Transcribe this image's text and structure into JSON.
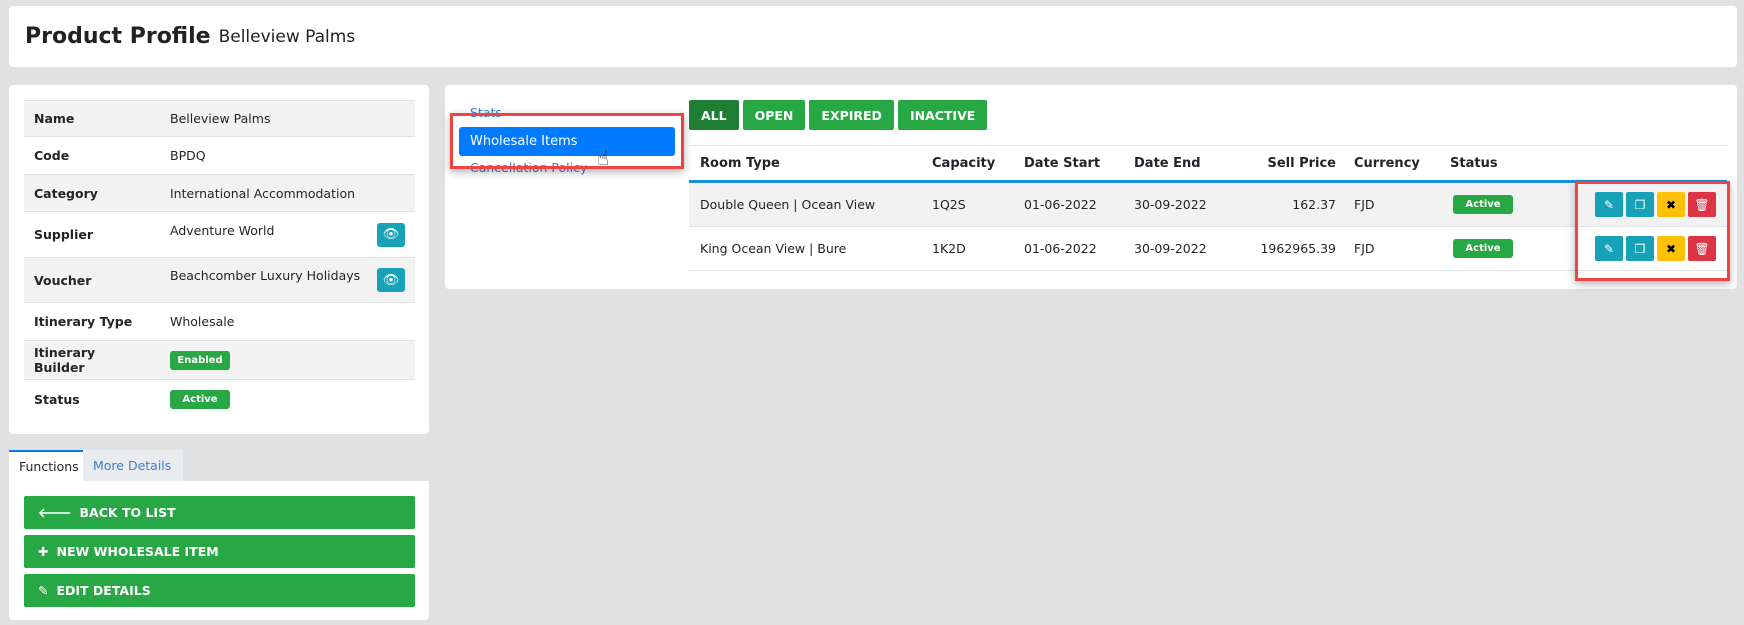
{
  "header": {
    "title": "Product Profile",
    "subtitle": "Belleview Palms"
  },
  "info": [
    {
      "label": "Name",
      "value": "Belleview Palms"
    },
    {
      "label": "Code",
      "value": "BPDQ"
    },
    {
      "label": "Category",
      "value": "International Accommodation"
    },
    {
      "label": "Supplier",
      "value": "Adventure World"
    },
    {
      "label": "Voucher",
      "value": "Beachcomber Luxury Holidays"
    },
    {
      "label": "Itinerary Type",
      "value": "Wholesale"
    },
    {
      "label": "Itinerary Builder",
      "value": "Enabled"
    },
    {
      "label": "Status",
      "value": "Active"
    }
  ],
  "tabs": {
    "functions": "Functions",
    "more": "More Details"
  },
  "functions": [
    "BACK TO LIST",
    "NEW WHOLESALE ITEM",
    "EDIT DETAILS"
  ],
  "nav": {
    "stats": "Stats",
    "wholesale": "Wholesale Items",
    "cancellation": "Cancellation Policy"
  },
  "filters": [
    "ALL",
    "OPEN",
    "EXPIRED",
    "INACTIVE"
  ],
  "table": {
    "headers": [
      "Room Type",
      "Capacity",
      "Date Start",
      "Date End",
      "Sell Price",
      "Currency",
      "Status"
    ],
    "rows": [
      [
        "Double Queen | Ocean View",
        "1Q2S",
        "01-06-2022",
        "30-09-2022",
        "162.37",
        "FJD",
        "Active"
      ],
      [
        "King Ocean View | Bure",
        "1K2D",
        "01-06-2022",
        "30-09-2022",
        "1962965.39",
        "FJD",
        "Active"
      ]
    ]
  },
  "colors": {
    "green": "#28a745",
    "blue": "#007bff",
    "teal": "#17a2b8",
    "yellow": "#ffc107",
    "red": "#dc3545"
  }
}
